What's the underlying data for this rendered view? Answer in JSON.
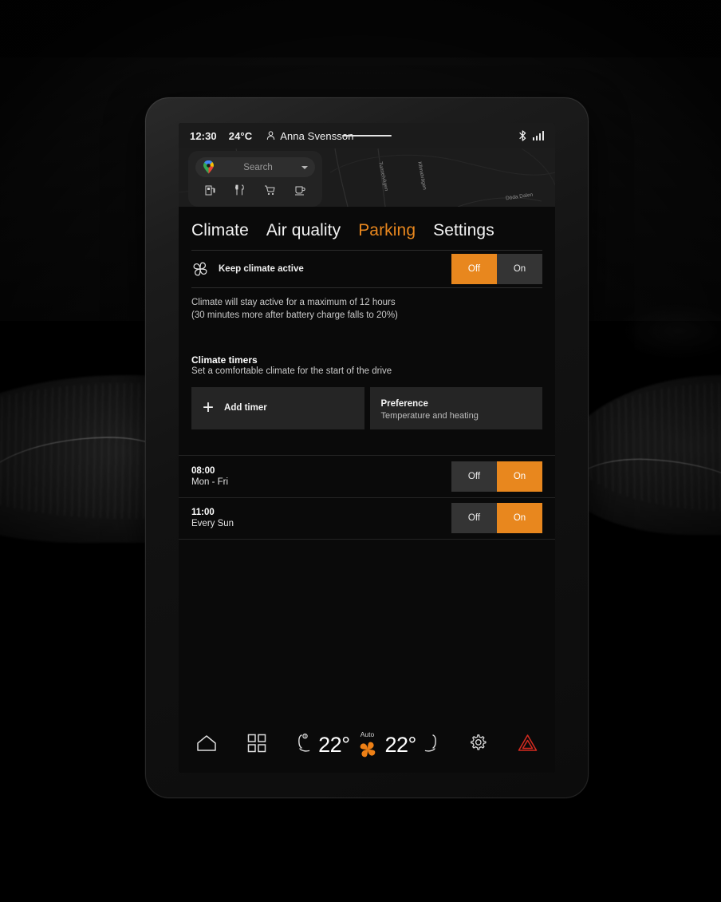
{
  "status_bar": {
    "time": "12:30",
    "temperature": "24°C",
    "user_name": "Anna Svensson",
    "user_icon": "person-icon",
    "bluetooth_icon": "bluetooth-icon",
    "signal_icon": "signal-bars-icon"
  },
  "map_widget": {
    "search_placeholder": "Search",
    "maps_icon": "google-maps-pin-icon",
    "chevron_icon": "chevron-down-icon",
    "categories": [
      {
        "name": "fuel-icon",
        "glyph": "⛽"
      },
      {
        "name": "restaurant-icon",
        "glyph": "🍴"
      },
      {
        "name": "shopping-icon",
        "glyph": "🛒"
      },
      {
        "name": "coffee-icon",
        "glyph": "☕"
      }
    ],
    "street_labels": [
      "Tunnelvägen",
      "Klimatvägen",
      "Döda Dalen"
    ]
  },
  "tabs": [
    {
      "label": "Climate",
      "active": false
    },
    {
      "label": "Air quality",
      "active": false
    },
    {
      "label": "Parking",
      "active": true
    },
    {
      "label": "Settings",
      "active": false
    }
  ],
  "keep_climate": {
    "icon": "fan-icon",
    "label": "Keep climate active",
    "options": [
      "Off",
      "On"
    ],
    "selected": "Off"
  },
  "note": {
    "line1": "Climate will stay active for a maximum of 12 hours",
    "line2": "(30 minutes more after battery charge falls to 20%)"
  },
  "timers_section": {
    "title": "Climate timers",
    "subtitle": "Set a comfortable climate for the start of the drive",
    "add_timer": {
      "label": "Add timer",
      "icon": "plus-icon"
    },
    "preference": {
      "title": "Preference",
      "subtitle": "Temperature and heating"
    }
  },
  "timers": [
    {
      "time": "08:00",
      "days": "Mon - Fri",
      "options": [
        "Off",
        "On"
      ],
      "selected": "On"
    },
    {
      "time": "11:00",
      "days": "Every Sun",
      "options": [
        "Off",
        "On"
      ],
      "selected": "On"
    }
  ],
  "bottom_bar": {
    "home_icon": "home-icon",
    "apps_icon": "apps-grid-icon",
    "left_seat_icon": "seat-heat-left-icon",
    "left_temp": "22°",
    "fan_label": "Auto",
    "fan_icon": "fan-auto-icon",
    "right_temp": "22°",
    "right_seat_icon": "seat-heat-right-icon",
    "settings_icon": "gear-icon",
    "hazard_icon": "hazard-triangle-icon"
  },
  "colors": {
    "accent": "#e8871e",
    "hazard": "#d42b20",
    "screen_bg": "#0a0a0a",
    "card_bg": "#252525",
    "segment_bg": "#343434"
  }
}
